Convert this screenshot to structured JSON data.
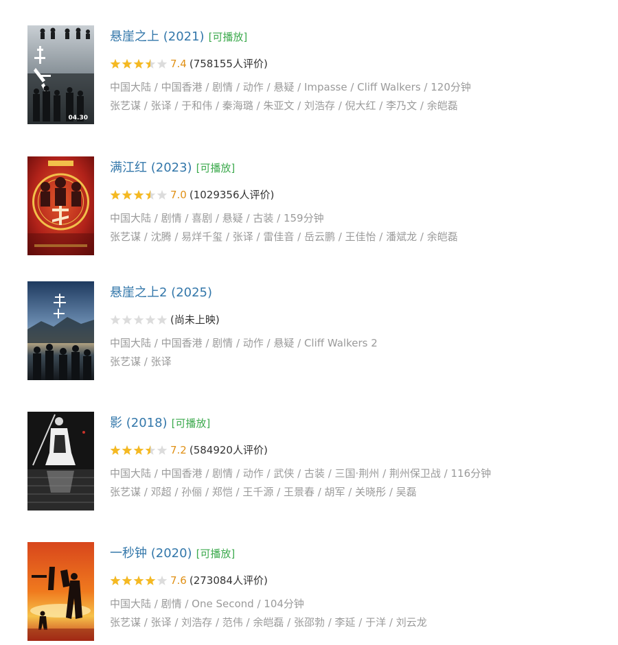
{
  "colors": {
    "title": "#3377aa",
    "playable": "#3ba94c",
    "star_filled": "#f5b922",
    "star_empty": "#dcdcdc",
    "score": "#e09015",
    "meta_text": "#9a9a9a"
  },
  "movies": [
    {
      "title": "悬崖之上 (2021)",
      "playable_label": "[可播放]",
      "stars": 3.5,
      "score": "7.4",
      "rating_count": "(758155人评价)",
      "info_line": "中国大陆 / 中国香港 / 剧情 / 动作 / 悬疑 / Impasse / Cliff Walkers / 120分钟",
      "cast_line": "张艺谋 / 张译 / 于和伟 / 秦海璐 / 朱亚文 / 刘浩存 / 倪大红 / 李乃文 / 余皑磊",
      "poster_text": "04.30",
      "poster_icon": "poster-cliff-walkers"
    },
    {
      "title": "满江红 (2023)",
      "playable_label": "[可播放]",
      "stars": 3.5,
      "score": "7.0",
      "rating_count": "(1029356人评价)",
      "info_line": "中国大陆 / 剧情 / 喜剧 / 悬疑 / 古装 / 159分钟",
      "cast_line": "张艺谋 / 沈腾 / 易烊千玺 / 张译 / 雷佳音 / 岳云鹏 / 王佳怡 / 潘斌龙 / 余皑磊",
      "poster_text": "",
      "poster_icon": "poster-full-river-red"
    },
    {
      "title": "悬崖之上2 (2025)",
      "playable_label": "",
      "stars": 0,
      "score": "",
      "rating_count": "(尚未上映)",
      "info_line": "中国大陆 / 中国香港 / 剧情 / 动作 / 悬疑 / Cliff Walkers 2",
      "cast_line": "张艺谋 / 张译",
      "poster_text": "",
      "poster_icon": "poster-cliff-walkers-2"
    },
    {
      "title": "影 (2018)",
      "playable_label": "[可播放]",
      "stars": 3.5,
      "score": "7.2",
      "rating_count": "(584920人评价)",
      "info_line": "中国大陆 / 中国香港 / 剧情 / 动作 / 武侠 / 古装 / 三国·荆州 / 荆州保卫战 / 116分钟",
      "cast_line": "张艺谋 / 邓超 / 孙俪 / 郑恺 / 王千源 / 王景春 / 胡军 / 关晓彤 / 吴磊",
      "poster_text": "",
      "poster_icon": "poster-shadow"
    },
    {
      "title": "一秒钟 (2020)",
      "playable_label": "[可播放]",
      "stars": 4,
      "score": "7.6",
      "rating_count": "(273084人评价)",
      "info_line": "中国大陆 / 剧情 / One Second / 104分钟",
      "cast_line": "张艺谋 / 张译 / 刘浩存 / 范伟 / 余皑磊 / 张邵勃 / 李延 / 于洋 / 刘云龙",
      "poster_text": "",
      "poster_icon": "poster-one-second"
    }
  ]
}
